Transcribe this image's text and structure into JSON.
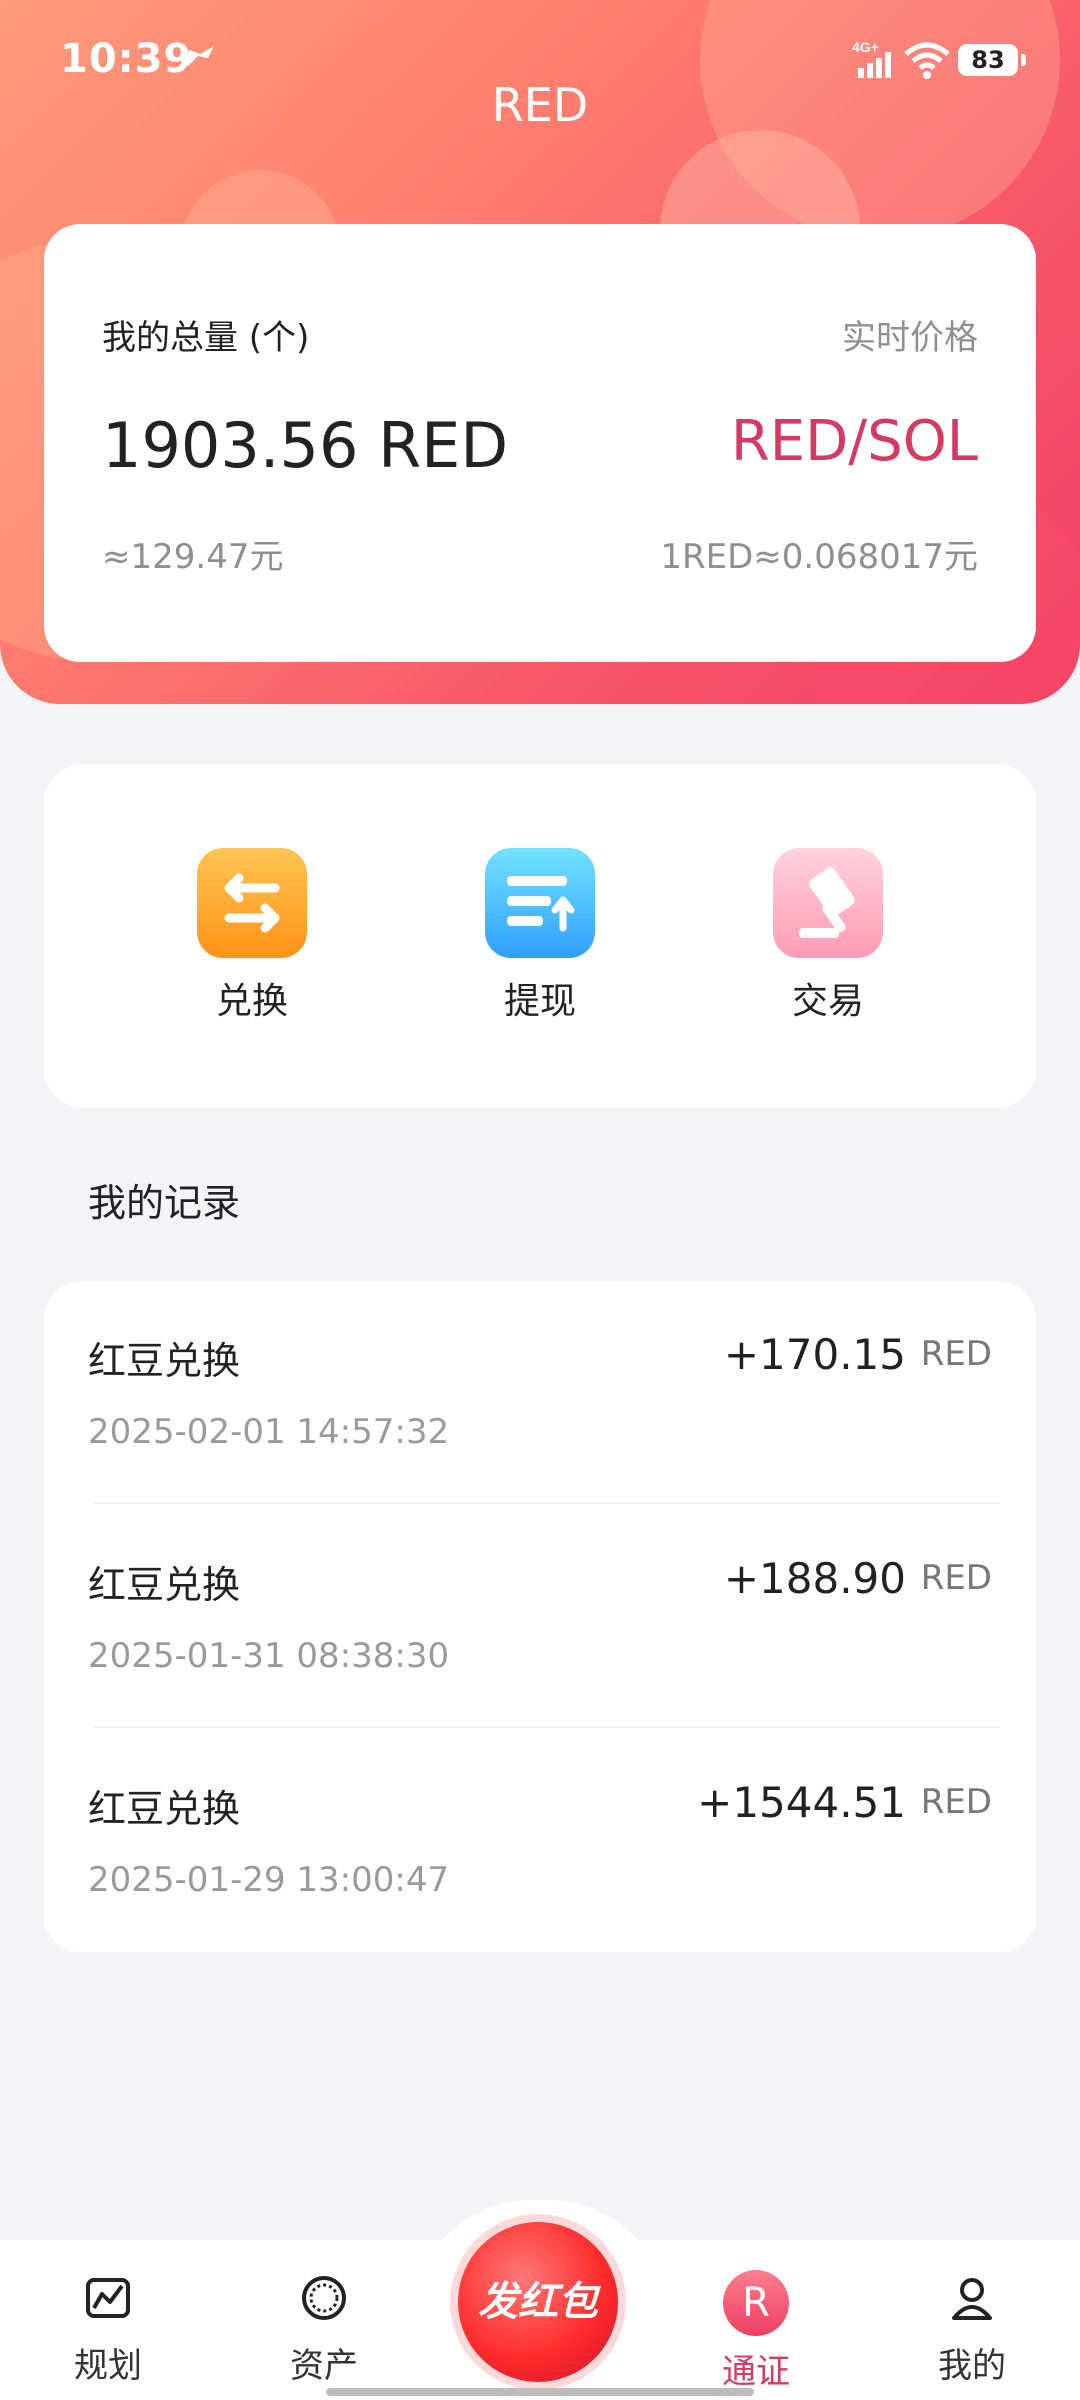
{
  "status_bar": {
    "time": "10:39",
    "network": "4G+",
    "battery": "83"
  },
  "header": {
    "title": "RED"
  },
  "summary": {
    "total_label": "我的总量 (个)",
    "price_label": "实时价格",
    "amount": "1903.56 RED",
    "pair": "RED/SOL",
    "approx_value": "≈129.47元",
    "unit_price": "1RED≈0.068017元"
  },
  "actions": [
    {
      "label": "兑换",
      "icon": "exchange-icon"
    },
    {
      "label": "提现",
      "icon": "withdraw-icon"
    },
    {
      "label": "交易",
      "icon": "trade-icon"
    }
  ],
  "records": {
    "title": "我的记录",
    "items": [
      {
        "name": "红豆兑换",
        "time": "2025-02-01 14:57:32",
        "value": "+170.15",
        "unit": "RED"
      },
      {
        "name": "红豆兑换",
        "time": "2025-01-31 08:38:30",
        "value": "+188.90",
        "unit": "RED"
      },
      {
        "name": "红豆兑换",
        "time": "2025-01-29 13:00:47",
        "value": "+1544.51",
        "unit": "RED"
      }
    ]
  },
  "nav": {
    "items": [
      {
        "label": "规划",
        "icon": "plan-icon"
      },
      {
        "label": "资产",
        "icon": "assets-icon"
      },
      {
        "label": "通证",
        "icon": "token-icon",
        "badge": "R"
      },
      {
        "label": "我的",
        "icon": "profile-icon"
      }
    ],
    "center_button": "发红包"
  },
  "colors": {
    "accent": "#d63a63",
    "header_start": "#ff9a7a",
    "header_end": "#ef3f63"
  }
}
